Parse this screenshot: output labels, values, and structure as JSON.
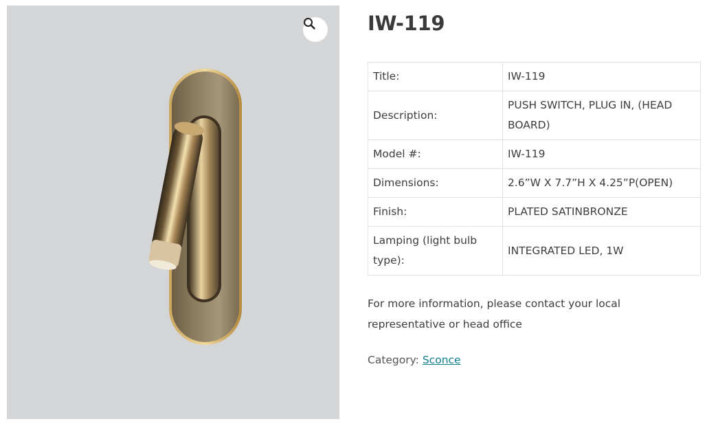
{
  "product": {
    "title": "IW-119",
    "image": {
      "zoom_icon": "magnifier-icon",
      "subject": "wall sconce, plated satin bronze"
    }
  },
  "attributes": [
    {
      "key": "Title:",
      "value": "IW-119"
    },
    {
      "key": "Description:",
      "value": "PUSH SWITCH, PLUG IN, (HEAD BOARD)"
    },
    {
      "key": "Model #:",
      "value": "IW-119"
    },
    {
      "key": "Dimensions:",
      "value": "2.6”W X 7.7”H X 4.25”P(OPEN)"
    },
    {
      "key": "Finish:",
      "value": "PLATED SATINBRONZE"
    },
    {
      "key": "Lamping (light bulb type):",
      "value": "INTEGRATED LED, 1W"
    }
  ],
  "contact_text": "For more information, please contact your local representative or head office",
  "category": {
    "label": "Category:",
    "link": "Sconce"
  },
  "colors": {
    "link": "#0f7f8e",
    "image_bg": "#d4d5d7",
    "border": "#e2e2e2"
  }
}
